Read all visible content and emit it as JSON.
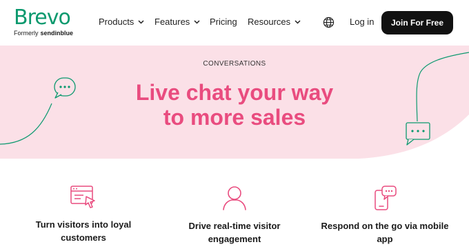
{
  "brand": {
    "name": "Brevo",
    "formerly_prefix": "Formerly",
    "formerly_brand": "sendinblue",
    "color": "#0b996e"
  },
  "nav": {
    "items": [
      {
        "label": "Products",
        "has_dropdown": true
      },
      {
        "label": "Features",
        "has_dropdown": true
      },
      {
        "label": "Pricing",
        "has_dropdown": false
      },
      {
        "label": "Resources",
        "has_dropdown": true
      }
    ],
    "language_icon": "globe-icon",
    "login_label": "Log in",
    "cta_label": "Join For Free"
  },
  "hero": {
    "eyebrow": "CONVERSATIONS",
    "title_line1": "Live chat your way",
    "title_line2": "to more sales",
    "background": "#fbe0e7",
    "accent": "#e94c7f"
  },
  "features": [
    {
      "icon": "browser-cursor-icon",
      "line1": "Turn visitors into loyal",
      "line2": "customers"
    },
    {
      "icon": "person-icon",
      "line1": "Drive real-time visitor",
      "line2": "engagement"
    },
    {
      "icon": "mobile-chat-icon",
      "line1": "Respond on the go via mobile",
      "line2": "app"
    }
  ]
}
